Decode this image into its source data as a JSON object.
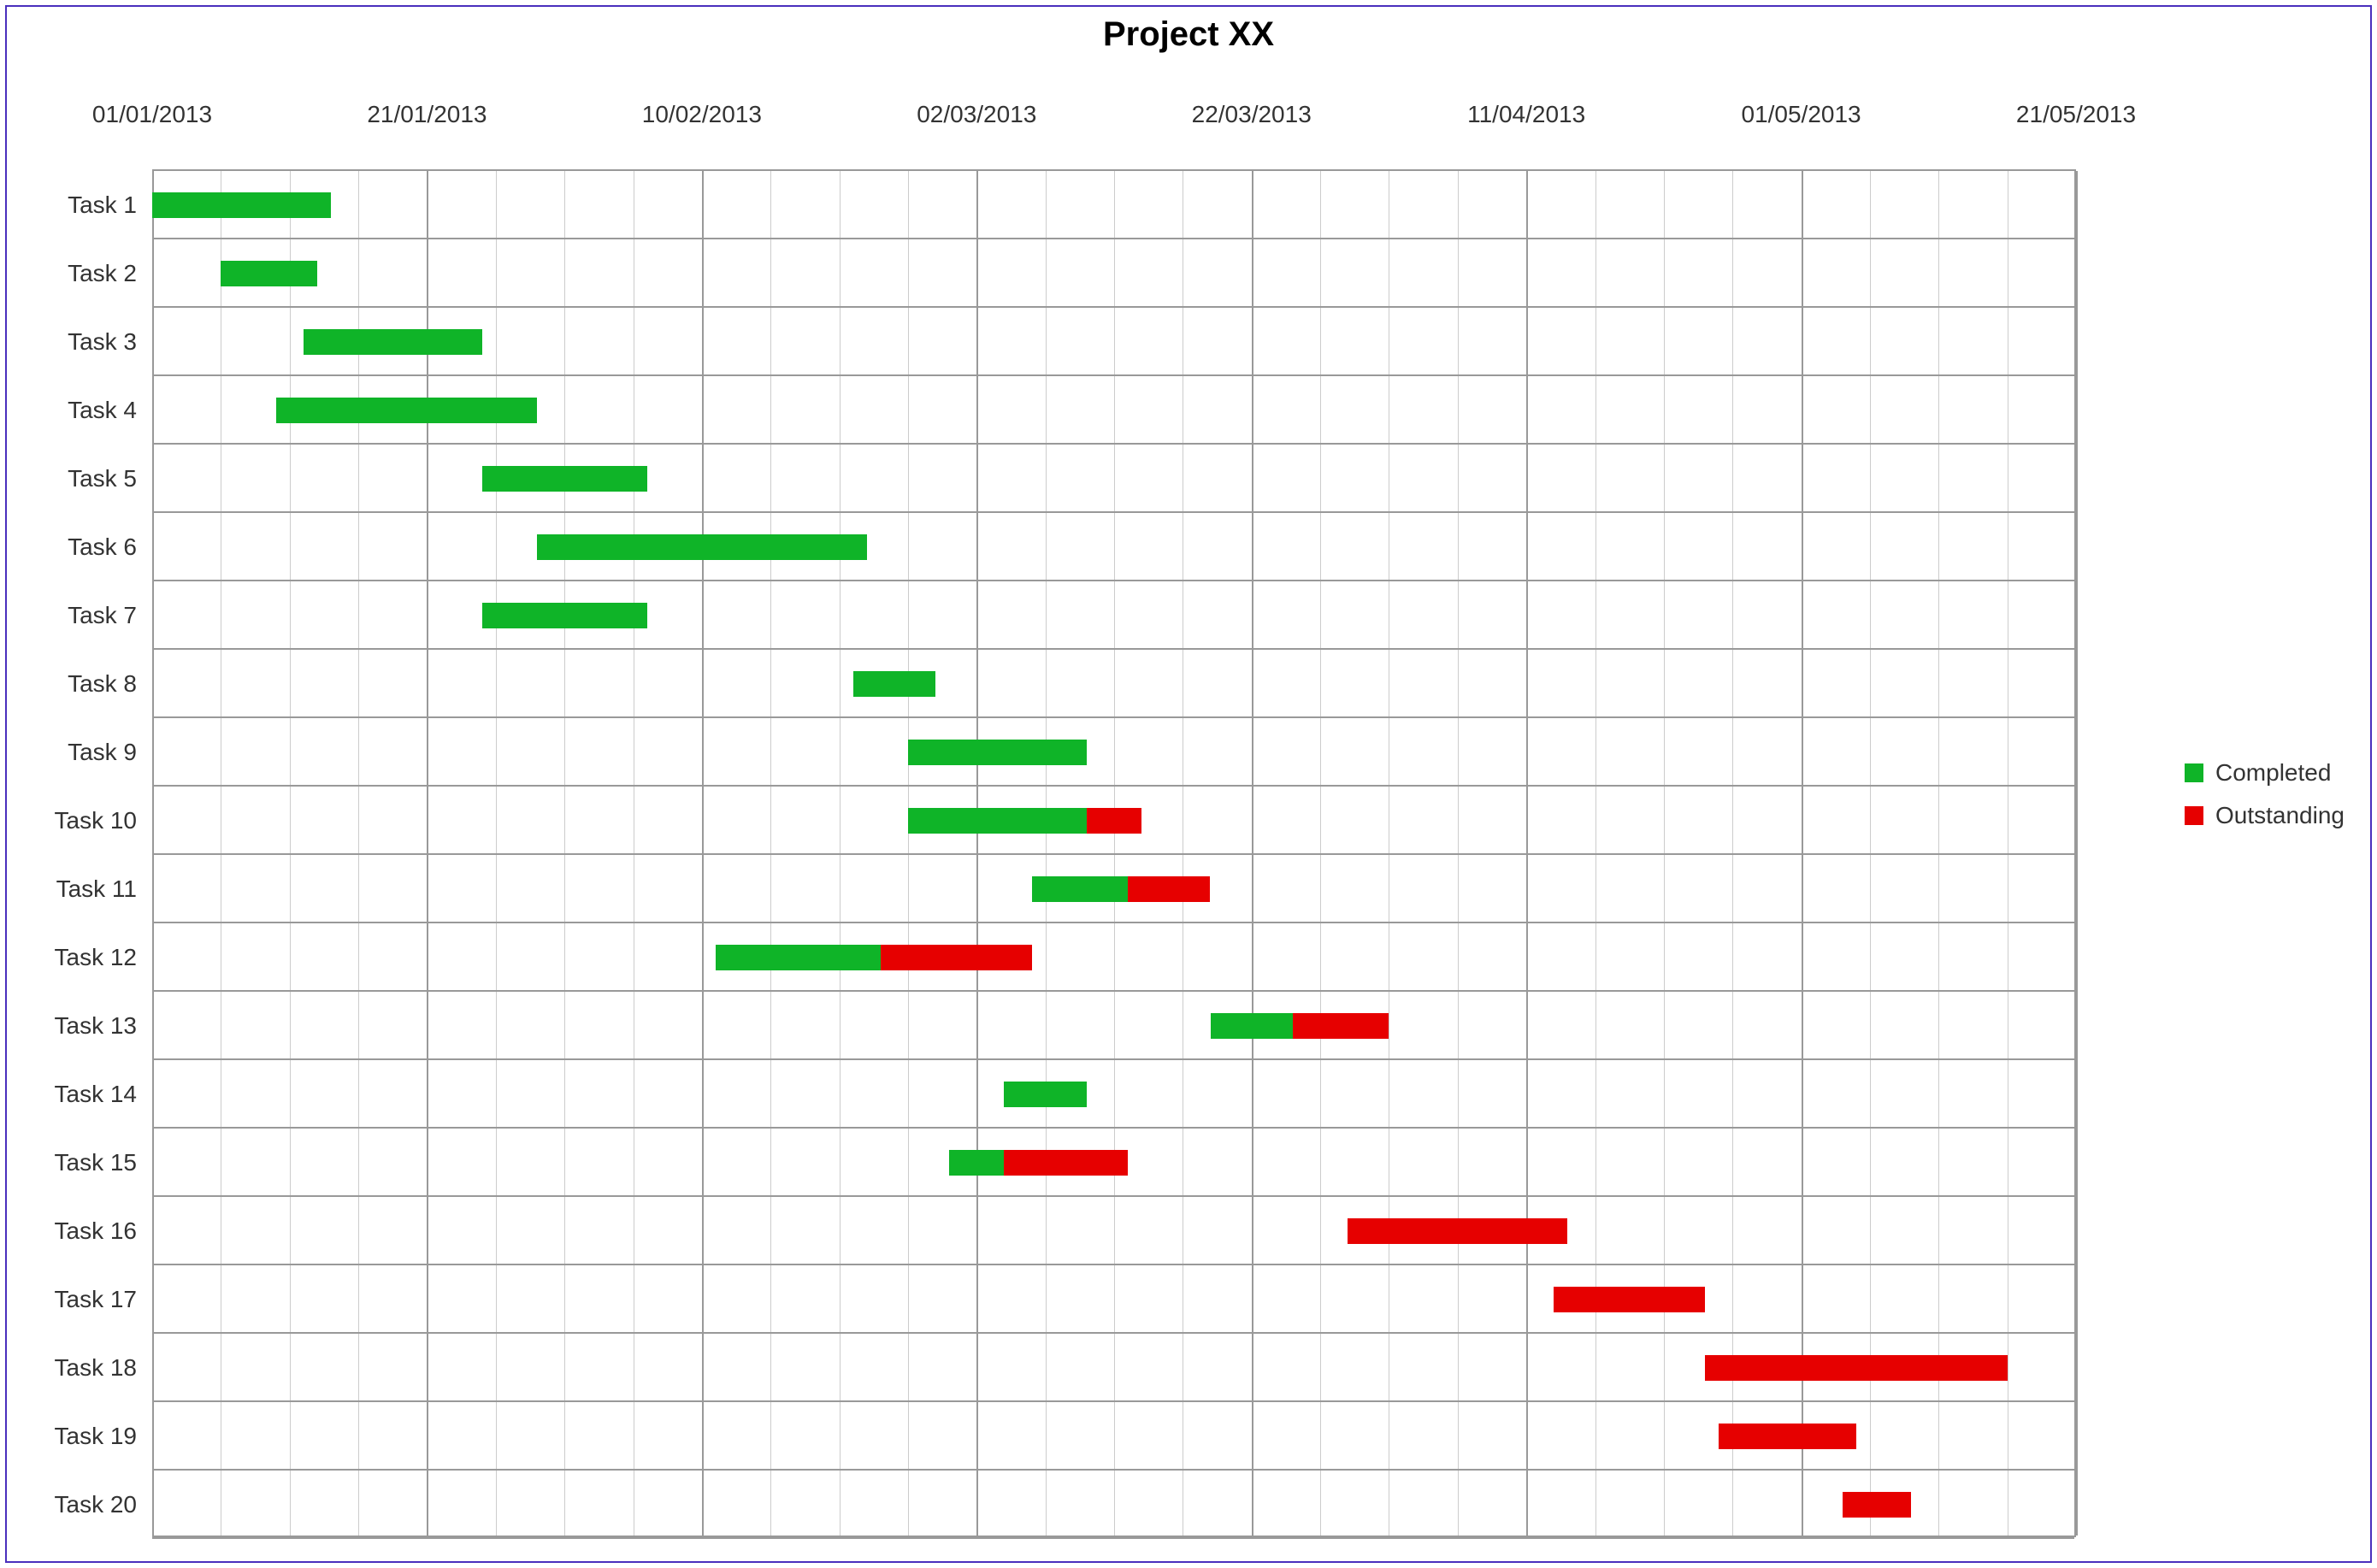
{
  "chart_data": {
    "type": "bar",
    "orientation": "horizontal-gantt",
    "title": "Project XX",
    "x_origin_days": 0,
    "x_major_step_days": 20,
    "x_minor_per_major": 4,
    "x_ticks": [
      "01/01/2013",
      "21/01/2013",
      "10/02/2013",
      "02/03/2013",
      "22/03/2013",
      "11/04/2013",
      "01/05/2013",
      "21/05/2013"
    ],
    "tasks": [
      {
        "name": "Task 1",
        "start": 0,
        "completed": 13,
        "outstanding": 0
      },
      {
        "name": "Task 2",
        "start": 5,
        "completed": 7,
        "outstanding": 0
      },
      {
        "name": "Task 3",
        "start": 11,
        "completed": 13,
        "outstanding": 0
      },
      {
        "name": "Task 4",
        "start": 9,
        "completed": 19,
        "outstanding": 0
      },
      {
        "name": "Task 5",
        "start": 24,
        "completed": 12,
        "outstanding": 0
      },
      {
        "name": "Task 6",
        "start": 28,
        "completed": 24,
        "outstanding": 0
      },
      {
        "name": "Task 7",
        "start": 24,
        "completed": 12,
        "outstanding": 0
      },
      {
        "name": "Task 8",
        "start": 51,
        "completed": 6,
        "outstanding": 0
      },
      {
        "name": "Task 9",
        "start": 55,
        "completed": 13,
        "outstanding": 0
      },
      {
        "name": "Task 10",
        "start": 55,
        "completed": 13,
        "outstanding": 4
      },
      {
        "name": "Task 11",
        "start": 64,
        "completed": 7,
        "outstanding": 6
      },
      {
        "name": "Task 12",
        "start": 41,
        "completed": 12,
        "outstanding": 11
      },
      {
        "name": "Task 13",
        "start": 77,
        "completed": 6,
        "outstanding": 7
      },
      {
        "name": "Task 14",
        "start": 62,
        "completed": 6,
        "outstanding": 0
      },
      {
        "name": "Task 15",
        "start": 58,
        "completed": 4,
        "outstanding": 9
      },
      {
        "name": "Task 16",
        "start": 87,
        "completed": 0,
        "outstanding": 16
      },
      {
        "name": "Task 17",
        "start": 102,
        "completed": 0,
        "outstanding": 11
      },
      {
        "name": "Task 18",
        "start": 113,
        "completed": 0,
        "outstanding": 22
      },
      {
        "name": "Task 19",
        "start": 114,
        "completed": 0,
        "outstanding": 10
      },
      {
        "name": "Task 20",
        "start": 123,
        "completed": 0,
        "outstanding": 5
      }
    ],
    "legend": {
      "completed": {
        "label": "Completed",
        "color": "#0fb428"
      },
      "outstanding": {
        "label": "Outstanding",
        "color": "#e60000"
      }
    }
  }
}
